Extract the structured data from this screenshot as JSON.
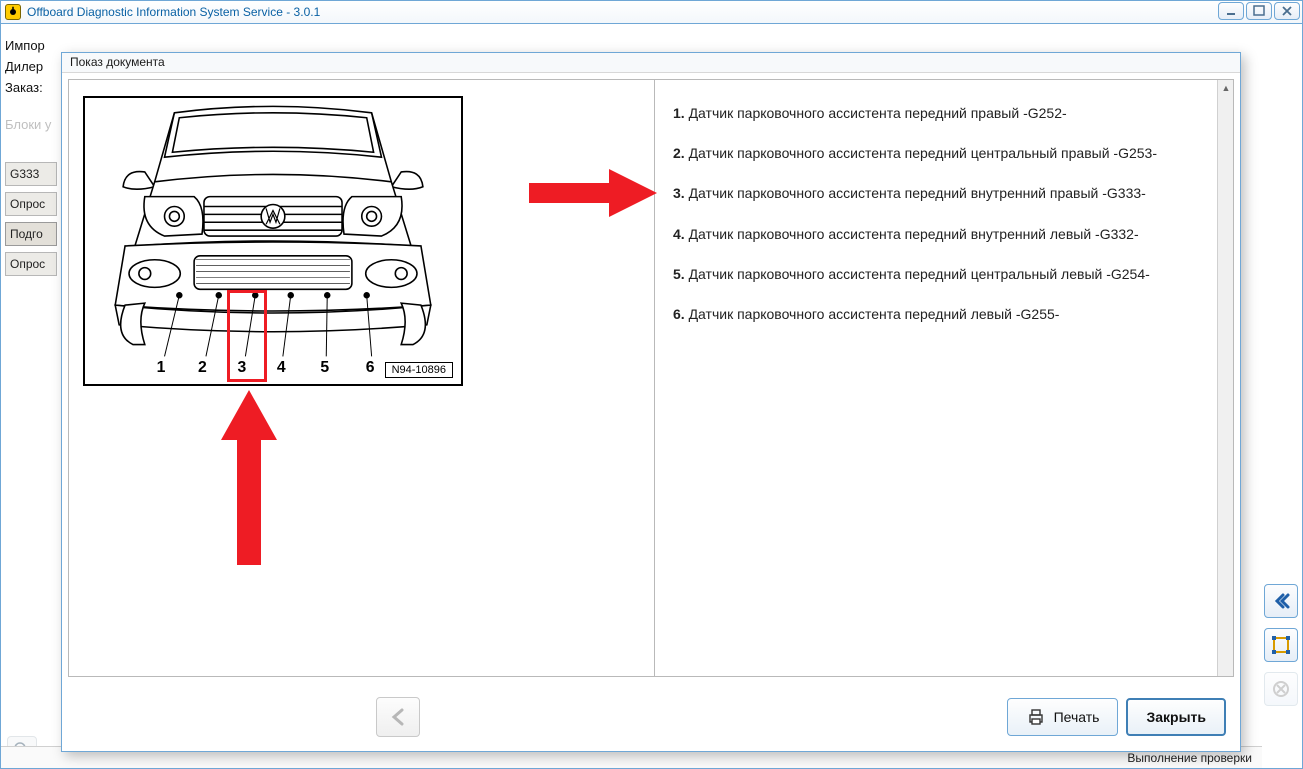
{
  "window": {
    "title": "Offboard Diagnostic Information System Service - 3.0.1"
  },
  "background": {
    "lines": [
      "Импор",
      "Дилер",
      "Заказ:"
    ],
    "muted": "Блоки у",
    "tabs": [
      "G333",
      "Опрос",
      "Подго",
      "Опрос"
    ]
  },
  "modal": {
    "title": "Показ документа",
    "diagram_code": "N94-10896",
    "diagram_numbers": [
      "1",
      "2",
      "3",
      "4",
      "5",
      "6"
    ],
    "items": [
      {
        "n": "1.",
        "text": "Датчик парковочного ассистента передний правый -G252-"
      },
      {
        "n": "2.",
        "text": "Датчик парковочного ассистента передний центральный правый -G253-"
      },
      {
        "n": "3.",
        "text": "Датчик парковочного ассистента передний внутренний правый -G333-"
      },
      {
        "n": "4.",
        "text": "Датчик парковочного ассистента передний внутренний левый -G332-"
      },
      {
        "n": "5.",
        "text": "Датчик парковочного ассистента передний центральный левый -G254-"
      },
      {
        "n": "6.",
        "text": "Датчик парковочного ассистента передний левый -G255-"
      }
    ],
    "print_label": "Печать",
    "close_label": "Закрыть"
  },
  "status": {
    "text": "Выполнение проверки"
  }
}
